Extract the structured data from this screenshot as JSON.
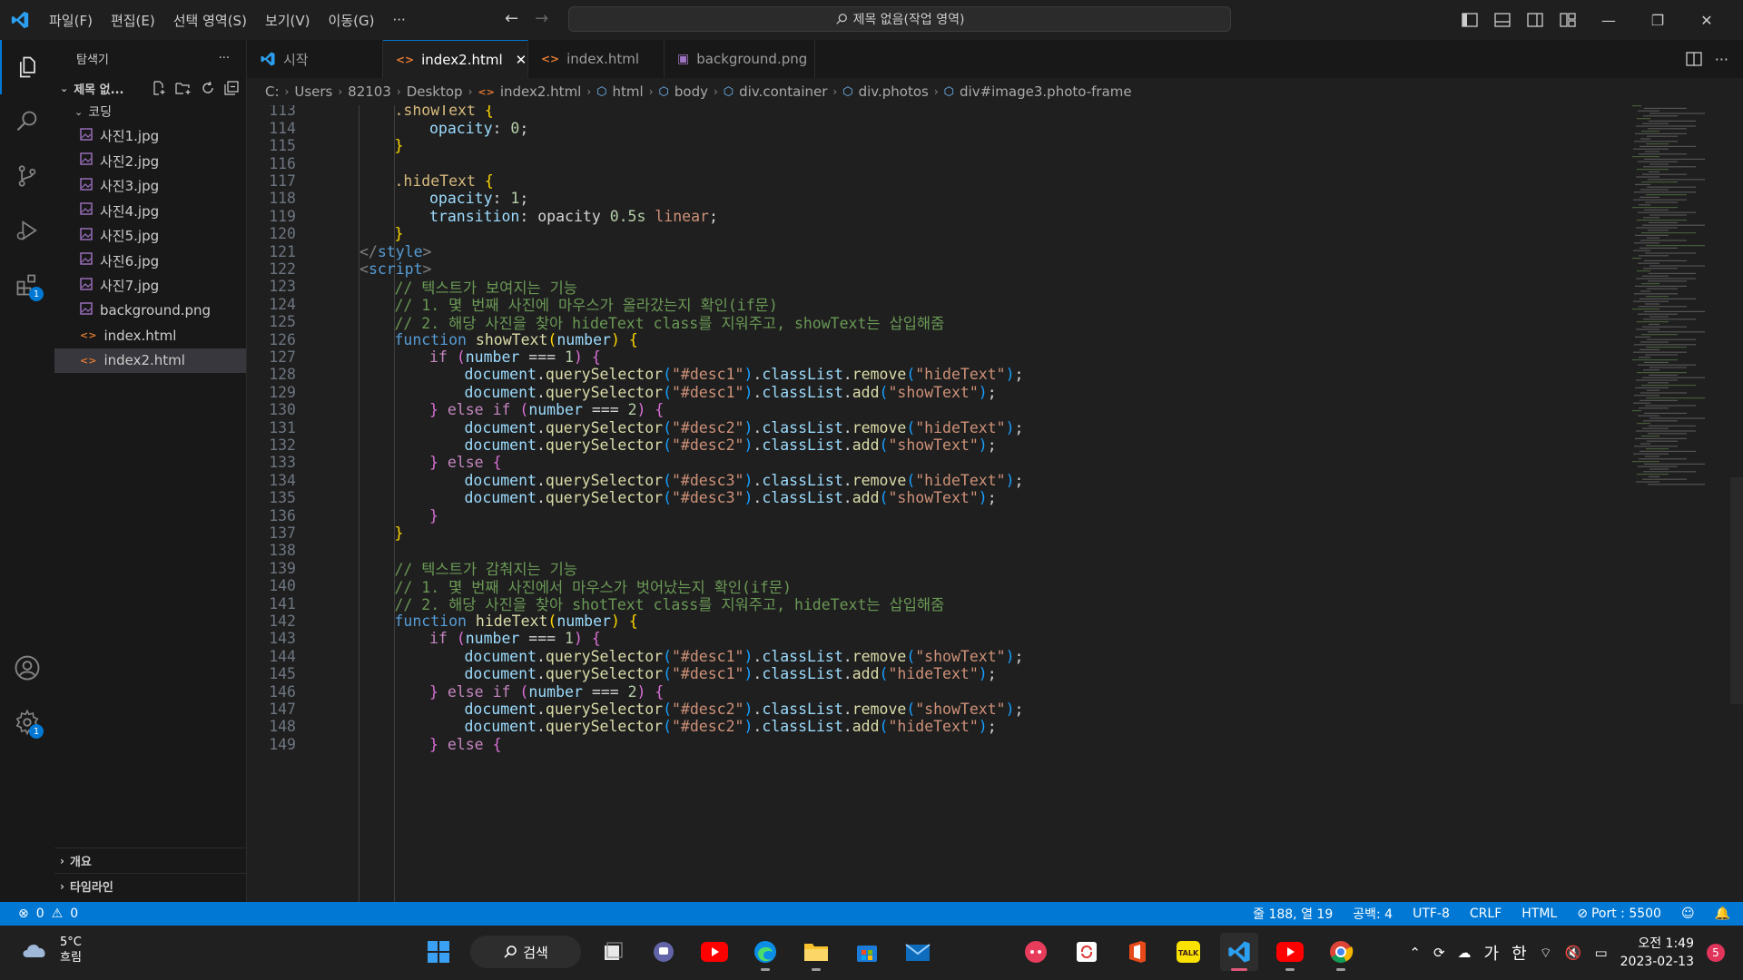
{
  "titlebar": {
    "menus": [
      "파일(F)",
      "편집(E)",
      "선택 영역(S)",
      "보기(V)",
      "이동(G)",
      "···"
    ],
    "search_text": "제목 없음(작업 영역)"
  },
  "activity": {
    "extensions_badge": "1",
    "settings_badge": "1"
  },
  "explorer": {
    "title": "탐색기",
    "more": "···",
    "workspace": "제목 없...",
    "folder": "코딩",
    "files": [
      {
        "name": "사진1.jpg",
        "type": "image"
      },
      {
        "name": "사진2.jpg",
        "type": "image"
      },
      {
        "name": "사진3.jpg",
        "type": "image"
      },
      {
        "name": "사진4.jpg",
        "type": "image"
      },
      {
        "name": "사진5.jpg",
        "type": "image"
      },
      {
        "name": "사진6.jpg",
        "type": "image"
      },
      {
        "name": "사진7.jpg",
        "type": "image"
      },
      {
        "name": "background.png",
        "type": "image"
      },
      {
        "name": "index.html",
        "type": "html"
      },
      {
        "name": "index2.html",
        "type": "html"
      }
    ],
    "outline": "개요",
    "timeline": "타임라인"
  },
  "tabs": [
    {
      "label": "시작",
      "icon": "vscode-icon"
    },
    {
      "label": "index2.html",
      "icon": "html-icon",
      "active": true
    },
    {
      "label": "index.html",
      "icon": "html-icon"
    },
    {
      "label": "background.png",
      "icon": "image-icon"
    }
  ],
  "breadcrumb": [
    "C:",
    "Users",
    "82103",
    "Desktop",
    "index2.html",
    "html",
    "body",
    "div.container",
    "div.photos",
    "div#image3.photo-frame"
  ],
  "code_lines": [
    {
      "n": "113",
      "indent": 1,
      "tokens": [
        [
          "sel",
          ".showText"
        ],
        [
          "op",
          " "
        ],
        [
          "br",
          "{"
        ]
      ]
    },
    {
      "n": "114",
      "indent": 2,
      "tokens": [
        [
          "var",
          "opacity"
        ],
        [
          "op",
          ": "
        ],
        [
          "num",
          "0"
        ],
        [
          "op",
          ";"
        ]
      ]
    },
    {
      "n": "115",
      "indent": 1,
      "tokens": [
        [
          "br",
          "}"
        ]
      ]
    },
    {
      "n": "116",
      "indent": 0,
      "tokens": []
    },
    {
      "n": "117",
      "indent": 1,
      "tokens": [
        [
          "sel",
          ".hideText"
        ],
        [
          "op",
          " "
        ],
        [
          "br",
          "{"
        ]
      ]
    },
    {
      "n": "118",
      "indent": 2,
      "tokens": [
        [
          "var",
          "opacity"
        ],
        [
          "op",
          ": "
        ],
        [
          "num",
          "1"
        ],
        [
          "op",
          ";"
        ]
      ]
    },
    {
      "n": "119",
      "indent": 2,
      "tokens": [
        [
          "var",
          "transition"
        ],
        [
          "op",
          ": opacity "
        ],
        [
          "num",
          "0.5s"
        ],
        [
          "op",
          " "
        ],
        [
          "str",
          "linear"
        ],
        [
          "op",
          ";"
        ]
      ]
    },
    {
      "n": "120",
      "indent": 1,
      "tokens": [
        [
          "br",
          "}"
        ]
      ]
    },
    {
      "n": "121",
      "indent": 0,
      "tokens": [
        [
          "tag",
          "</"
        ],
        [
          "tagn",
          "style"
        ],
        [
          "tag",
          ">"
        ]
      ]
    },
    {
      "n": "122",
      "indent": 0,
      "tokens": [
        [
          "tag",
          "<"
        ],
        [
          "tagn",
          "script"
        ],
        [
          "tag",
          ">"
        ]
      ]
    },
    {
      "n": "123",
      "indent": 1,
      "tokens": [
        [
          "cmt",
          "// 텍스트가 보여지는 기능"
        ]
      ]
    },
    {
      "n": "124",
      "indent": 1,
      "tokens": [
        [
          "cmt",
          "// 1. 몇 번째 사진에 마우스가 올라갔는지 확인(if문)"
        ]
      ]
    },
    {
      "n": "125",
      "indent": 1,
      "tokens": [
        [
          "cmt",
          "// 2. 해당 사진을 찾아 hideText class를 지워주고, showText는 삽입해줌"
        ]
      ]
    },
    {
      "n": "126",
      "indent": 1,
      "tokens": [
        [
          "kw",
          "function"
        ],
        [
          "op",
          " "
        ],
        [
          "fn",
          "showText"
        ],
        [
          "br",
          "("
        ],
        [
          "var",
          "number"
        ],
        [
          "br",
          ")"
        ],
        [
          "op",
          " "
        ],
        [
          "br",
          "{"
        ]
      ]
    },
    {
      "n": "127",
      "indent": 2,
      "tokens": [
        [
          "kw2",
          "if"
        ],
        [
          "op",
          " "
        ],
        [
          "br2",
          "("
        ],
        [
          "var",
          "number"
        ],
        [
          "op",
          " === "
        ],
        [
          "num",
          "1"
        ],
        [
          "br2",
          ")"
        ],
        [
          "op",
          " "
        ],
        [
          "br2",
          "{"
        ]
      ]
    },
    {
      "n": "128",
      "indent": 3,
      "tokens": [
        [
          "var",
          "document"
        ],
        [
          "op",
          "."
        ],
        [
          "fn",
          "querySelector"
        ],
        [
          "br3",
          "("
        ],
        [
          "str",
          "\"#desc1\""
        ],
        [
          "br3",
          ")"
        ],
        [
          "op",
          "."
        ],
        [
          "var",
          "classList"
        ],
        [
          "op",
          "."
        ],
        [
          "fn",
          "remove"
        ],
        [
          "br3",
          "("
        ],
        [
          "str",
          "\"hideText\""
        ],
        [
          "br3",
          ")"
        ],
        [
          "op",
          ";"
        ]
      ]
    },
    {
      "n": "129",
      "indent": 3,
      "tokens": [
        [
          "var",
          "document"
        ],
        [
          "op",
          "."
        ],
        [
          "fn",
          "querySelector"
        ],
        [
          "br3",
          "("
        ],
        [
          "str",
          "\"#desc1\""
        ],
        [
          "br3",
          ")"
        ],
        [
          "op",
          "."
        ],
        [
          "var",
          "classList"
        ],
        [
          "op",
          "."
        ],
        [
          "fn",
          "add"
        ],
        [
          "br3",
          "("
        ],
        [
          "str",
          "\"showText\""
        ],
        [
          "br3",
          ")"
        ],
        [
          "op",
          ";"
        ]
      ]
    },
    {
      "n": "130",
      "indent": 2,
      "tokens": [
        [
          "br2",
          "}"
        ],
        [
          "op",
          " "
        ],
        [
          "kw2",
          "else"
        ],
        [
          "op",
          " "
        ],
        [
          "kw2",
          "if"
        ],
        [
          "op",
          " "
        ],
        [
          "br2",
          "("
        ],
        [
          "var",
          "number"
        ],
        [
          "op",
          " === "
        ],
        [
          "num",
          "2"
        ],
        [
          "br2",
          ")"
        ],
        [
          "op",
          " "
        ],
        [
          "br2",
          "{"
        ]
      ]
    },
    {
      "n": "131",
      "indent": 3,
      "tokens": [
        [
          "var",
          "document"
        ],
        [
          "op",
          "."
        ],
        [
          "fn",
          "querySelector"
        ],
        [
          "br3",
          "("
        ],
        [
          "str",
          "\"#desc2\""
        ],
        [
          "br3",
          ")"
        ],
        [
          "op",
          "."
        ],
        [
          "var",
          "classList"
        ],
        [
          "op",
          "."
        ],
        [
          "fn",
          "remove"
        ],
        [
          "br3",
          "("
        ],
        [
          "str",
          "\"hideText\""
        ],
        [
          "br3",
          ")"
        ],
        [
          "op",
          ";"
        ]
      ]
    },
    {
      "n": "132",
      "indent": 3,
      "tokens": [
        [
          "var",
          "document"
        ],
        [
          "op",
          "."
        ],
        [
          "fn",
          "querySelector"
        ],
        [
          "br3",
          "("
        ],
        [
          "str",
          "\"#desc2\""
        ],
        [
          "br3",
          ")"
        ],
        [
          "op",
          "."
        ],
        [
          "var",
          "classList"
        ],
        [
          "op",
          "."
        ],
        [
          "fn",
          "add"
        ],
        [
          "br3",
          "("
        ],
        [
          "str",
          "\"showText\""
        ],
        [
          "br3",
          ")"
        ],
        [
          "op",
          ";"
        ]
      ]
    },
    {
      "n": "133",
      "indent": 2,
      "tokens": [
        [
          "br2",
          "}"
        ],
        [
          "op",
          " "
        ],
        [
          "kw2",
          "else"
        ],
        [
          "op",
          " "
        ],
        [
          "br2",
          "{"
        ]
      ]
    },
    {
      "n": "134",
      "indent": 3,
      "tokens": [
        [
          "var",
          "document"
        ],
        [
          "op",
          "."
        ],
        [
          "fn",
          "querySelector"
        ],
        [
          "br3",
          "("
        ],
        [
          "str",
          "\"#desc3\""
        ],
        [
          "br3",
          ")"
        ],
        [
          "op",
          "."
        ],
        [
          "var",
          "classList"
        ],
        [
          "op",
          "."
        ],
        [
          "fn",
          "remove"
        ],
        [
          "br3",
          "("
        ],
        [
          "str",
          "\"hideText\""
        ],
        [
          "br3",
          ")"
        ],
        [
          "op",
          ";"
        ]
      ]
    },
    {
      "n": "135",
      "indent": 3,
      "tokens": [
        [
          "var",
          "document"
        ],
        [
          "op",
          "."
        ],
        [
          "fn",
          "querySelector"
        ],
        [
          "br3",
          "("
        ],
        [
          "str",
          "\"#desc3\""
        ],
        [
          "br3",
          ")"
        ],
        [
          "op",
          "."
        ],
        [
          "var",
          "classList"
        ],
        [
          "op",
          "."
        ],
        [
          "fn",
          "add"
        ],
        [
          "br3",
          "("
        ],
        [
          "str",
          "\"showText\""
        ],
        [
          "br3",
          ")"
        ],
        [
          "op",
          ";"
        ]
      ]
    },
    {
      "n": "136",
      "indent": 2,
      "tokens": [
        [
          "br2",
          "}"
        ]
      ]
    },
    {
      "n": "137",
      "indent": 1,
      "tokens": [
        [
          "br",
          "}"
        ]
      ]
    },
    {
      "n": "138",
      "indent": 0,
      "tokens": []
    },
    {
      "n": "139",
      "indent": 1,
      "tokens": [
        [
          "cmt",
          "// 텍스트가 감춰지는 기능"
        ]
      ]
    },
    {
      "n": "140",
      "indent": 1,
      "tokens": [
        [
          "cmt",
          "// 1. 몇 번째 사진에서 마우스가 벗어났는지 확인(if문)"
        ]
      ]
    },
    {
      "n": "141",
      "indent": 1,
      "tokens": [
        [
          "cmt",
          "// 2. 해당 사진을 찾아 shotText class를 지워주고, hideText는 삽입해줌"
        ]
      ]
    },
    {
      "n": "142",
      "indent": 1,
      "tokens": [
        [
          "kw",
          "function"
        ],
        [
          "op",
          " "
        ],
        [
          "fn",
          "hideText"
        ],
        [
          "br",
          "("
        ],
        [
          "var",
          "number"
        ],
        [
          "br",
          ")"
        ],
        [
          "op",
          " "
        ],
        [
          "br",
          "{"
        ]
      ]
    },
    {
      "n": "143",
      "indent": 2,
      "tokens": [
        [
          "kw2",
          "if"
        ],
        [
          "op",
          " "
        ],
        [
          "br2",
          "("
        ],
        [
          "var",
          "number"
        ],
        [
          "op",
          " === "
        ],
        [
          "num",
          "1"
        ],
        [
          "br2",
          ")"
        ],
        [
          "op",
          " "
        ],
        [
          "br2",
          "{"
        ]
      ]
    },
    {
      "n": "144",
      "indent": 3,
      "tokens": [
        [
          "var",
          "document"
        ],
        [
          "op",
          "."
        ],
        [
          "fn",
          "querySelector"
        ],
        [
          "br3",
          "("
        ],
        [
          "str",
          "\"#desc1\""
        ],
        [
          "br3",
          ")"
        ],
        [
          "op",
          "."
        ],
        [
          "var",
          "classList"
        ],
        [
          "op",
          "."
        ],
        [
          "fn",
          "remove"
        ],
        [
          "br3",
          "("
        ],
        [
          "str",
          "\"showText\""
        ],
        [
          "br3",
          ")"
        ],
        [
          "op",
          ";"
        ]
      ]
    },
    {
      "n": "145",
      "indent": 3,
      "tokens": [
        [
          "var",
          "document"
        ],
        [
          "op",
          "."
        ],
        [
          "fn",
          "querySelector"
        ],
        [
          "br3",
          "("
        ],
        [
          "str",
          "\"#desc1\""
        ],
        [
          "br3",
          ")"
        ],
        [
          "op",
          "."
        ],
        [
          "var",
          "classList"
        ],
        [
          "op",
          "."
        ],
        [
          "fn",
          "add"
        ],
        [
          "br3",
          "("
        ],
        [
          "str",
          "\"hideText\""
        ],
        [
          "br3",
          ")"
        ],
        [
          "op",
          ";"
        ]
      ]
    },
    {
      "n": "146",
      "indent": 2,
      "tokens": [
        [
          "br2",
          "}"
        ],
        [
          "op",
          " "
        ],
        [
          "kw2",
          "else"
        ],
        [
          "op",
          " "
        ],
        [
          "kw2",
          "if"
        ],
        [
          "op",
          " "
        ],
        [
          "br2",
          "("
        ],
        [
          "var",
          "number"
        ],
        [
          "op",
          " === "
        ],
        [
          "num",
          "2"
        ],
        [
          "br2",
          ")"
        ],
        [
          "op",
          " "
        ],
        [
          "br2",
          "{"
        ]
      ]
    },
    {
      "n": "147",
      "indent": 3,
      "tokens": [
        [
          "var",
          "document"
        ],
        [
          "op",
          "."
        ],
        [
          "fn",
          "querySelector"
        ],
        [
          "br3",
          "("
        ],
        [
          "str",
          "\"#desc2\""
        ],
        [
          "br3",
          ")"
        ],
        [
          "op",
          "."
        ],
        [
          "var",
          "classList"
        ],
        [
          "op",
          "."
        ],
        [
          "fn",
          "remove"
        ],
        [
          "br3",
          "("
        ],
        [
          "str",
          "\"showText\""
        ],
        [
          "br3",
          ")"
        ],
        [
          "op",
          ";"
        ]
      ]
    },
    {
      "n": "148",
      "indent": 3,
      "tokens": [
        [
          "var",
          "document"
        ],
        [
          "op",
          "."
        ],
        [
          "fn",
          "querySelector"
        ],
        [
          "br3",
          "("
        ],
        [
          "str",
          "\"#desc2\""
        ],
        [
          "br3",
          ")"
        ],
        [
          "op",
          "."
        ],
        [
          "var",
          "classList"
        ],
        [
          "op",
          "."
        ],
        [
          "fn",
          "add"
        ],
        [
          "br3",
          "("
        ],
        [
          "str",
          "\"hideText\""
        ],
        [
          "br3",
          ")"
        ],
        [
          "op",
          ";"
        ]
      ]
    },
    {
      "n": "149",
      "indent": 2,
      "tokens": [
        [
          "br2",
          "}"
        ],
        [
          "op",
          " "
        ],
        [
          "kw2",
          "else"
        ],
        [
          "op",
          " "
        ],
        [
          "br2",
          "{"
        ]
      ]
    }
  ],
  "status": {
    "errors": "0",
    "warnings": "0",
    "position": "줄 188, 열 19",
    "spaces": "공백: 4",
    "encoding": "UTF-8",
    "eol": "CRLF",
    "language": "HTML",
    "port": "Port : 5500"
  },
  "taskbar": {
    "temp": "5°C",
    "weather": "흐림",
    "search": "검색",
    "ime1": "가",
    "ime2": "한",
    "time": "오전 1:49",
    "date": "2023-02-13",
    "notif": "5"
  },
  "colors": {
    "accent": "#0078d4",
    "statusbar": "#0078d4",
    "editor_bg": "#1f1f1f"
  }
}
